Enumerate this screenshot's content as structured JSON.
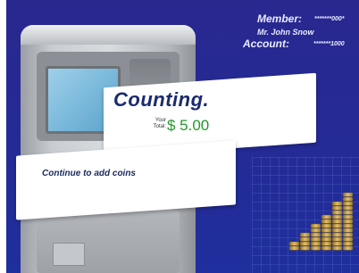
{
  "member": {
    "member_label": "Member:",
    "member_value": "*******000*",
    "name": "Mr. John Snow",
    "account_label": "Account:",
    "account_value": "*******1000"
  },
  "counting": {
    "title": "Counting.",
    "total_label_line1": "Your",
    "total_label_line2": "Total:",
    "total_value": "$ 5.00"
  },
  "prompt": {
    "text": "Continue to add coins"
  },
  "colors": {
    "background": "#2a2a90",
    "total_value": "#1f9a2b",
    "coin": "#c9a24a"
  },
  "icons": {
    "atm": "atm-machine-icon",
    "coins": "coin-stacks-icon"
  }
}
